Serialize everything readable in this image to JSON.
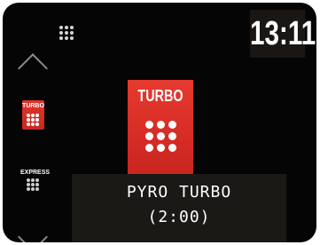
{
  "clock": {
    "time": "13:11"
  },
  "menu": {
    "icon": "menu-dots-icon"
  },
  "sidebar": {
    "up_icon": "chevron-up-icon",
    "down_icon": "chevron-down-icon",
    "items": [
      {
        "label": "TURBO",
        "active": true
      },
      {
        "label": "EXPRESS",
        "active": false
      }
    ]
  },
  "selected_program": {
    "icon_label": "TURBO",
    "name": "PYRO TURBO",
    "duration": "(2:00)"
  },
  "colors": {
    "accent": "#e0342a",
    "background": "#050505",
    "panel": "#1b1916"
  }
}
